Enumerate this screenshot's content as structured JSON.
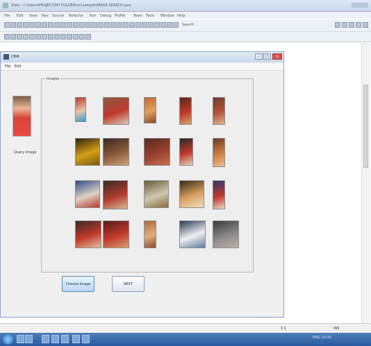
{
  "ide": {
    "title": "Vista - C:\\Users\\PROJECT\\MY FOLDER\\src\\sample\\IMAGE SEARCH.java",
    "menu": [
      "File",
      "Edit",
      "View",
      "Nav",
      "Source",
      "Refactor",
      "Run",
      "Debug",
      "Profile",
      "Team",
      "Tools",
      "Window",
      "Help"
    ],
    "search_label": "Search",
    "status": {
      "position": "1:1",
      "mode": "INS"
    }
  },
  "frame": {
    "title": "CBIR",
    "menu": [
      "File",
      "Edit"
    ],
    "preview_label": "Query Image",
    "panel_title": "Images",
    "thumbnails": [
      {
        "row": 0,
        "col": 0,
        "colors": [
          "#b03a2e",
          "#e9c6a8",
          "#3a9ad9"
        ]
      },
      {
        "row": 0,
        "col": 1,
        "colors": [
          "#8c5a44",
          "#c0392b",
          "#d9c9b5"
        ]
      },
      {
        "row": 0,
        "col": 2,
        "colors": [
          "#c26b2f",
          "#e0a060",
          "#8b4a2a"
        ]
      },
      {
        "row": 0,
        "col": 3,
        "colors": [
          "#5a2a1c",
          "#c0392b",
          "#d4a373"
        ]
      },
      {
        "row": 0,
        "col": 4,
        "colors": [
          "#6b3b2a",
          "#b7543a",
          "#d8b48a"
        ]
      },
      {
        "row": 1,
        "col": 0,
        "colors": [
          "#2e2410",
          "#d4a017",
          "#7a5a15"
        ]
      },
      {
        "row": 1,
        "col": 1,
        "colors": [
          "#3a2a20",
          "#8a5a3a",
          "#c9a27a"
        ]
      },
      {
        "row": 1,
        "col": 2,
        "colors": [
          "#5a2a22",
          "#9a4030",
          "#c87050"
        ]
      },
      {
        "row": 1,
        "col": 3,
        "colors": [
          "#2a2a2a",
          "#c0392b",
          "#e0d0c0"
        ]
      },
      {
        "row": 1,
        "col": 4,
        "colors": [
          "#6a3a22",
          "#d08040",
          "#e8c090"
        ]
      },
      {
        "row": 2,
        "col": 0,
        "colors": [
          "#2f4f8f",
          "#e0d0c0",
          "#b03a2e"
        ]
      },
      {
        "row": 2,
        "col": 1,
        "colors": [
          "#3a2a28",
          "#b03a2e",
          "#d8b898"
        ]
      },
      {
        "row": 2,
        "col": 2,
        "colors": [
          "#6a5a3a",
          "#cfc7b0",
          "#8a6a3a"
        ]
      },
      {
        "row": 2,
        "col": 3,
        "colors": [
          "#3a2a18",
          "#d8a060",
          "#f0e0c0"
        ]
      },
      {
        "row": 2,
        "col": 4,
        "colors": [
          "#2a3a6a",
          "#c0392b",
          "#e8d8c8"
        ]
      },
      {
        "row": 3,
        "col": 0,
        "colors": [
          "#3a2a24",
          "#c0392b",
          "#e0c0a0"
        ]
      },
      {
        "row": 3,
        "col": 1,
        "colors": [
          "#5a1a18",
          "#c0392b",
          "#d8a070"
        ]
      },
      {
        "row": 3,
        "col": 2,
        "colors": [
          "#b06a3a",
          "#e0b080",
          "#8a4a2a"
        ]
      },
      {
        "row": 3,
        "col": 3,
        "colors": [
          "#2a3a5a",
          "#f0f0f0",
          "#5a7aa0"
        ]
      },
      {
        "row": 3,
        "col": 4,
        "colors": [
          "#3a3a3a",
          "#8a8a8a",
          "#c0b0a0"
        ]
      }
    ],
    "buttons": {
      "choose": "Choose Image",
      "next": "NEXT"
    }
  },
  "taskbar": {
    "clock": "ENG 10:30"
  }
}
